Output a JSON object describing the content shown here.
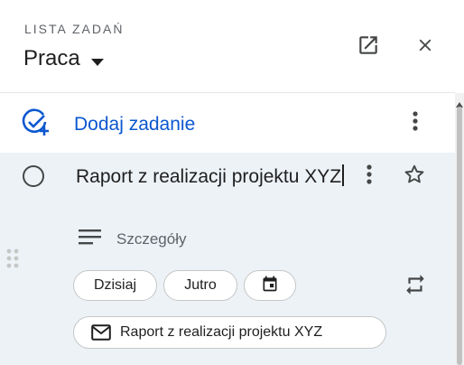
{
  "header": {
    "caption": "LISTA ZADAŃ",
    "list_name": "Praca",
    "icons": {
      "open": "open-in-new-icon",
      "close": "close-icon",
      "dropdown": "caret-down-icon"
    }
  },
  "add_task": {
    "label": "Dodaj zadanie",
    "icon": "add-task-icon",
    "more_icon": "more-vert-icon"
  },
  "task": {
    "title": "Raport z realizacji projektu XYZ",
    "details_label": "Szczegóły",
    "chips": {
      "today": "Dzisiaj",
      "tomorrow": "Jutro"
    },
    "email_label": "Raport z realizacji projektu XYZ",
    "icons": {
      "complete": "circle-icon",
      "more": "more-vert-icon",
      "star": "star-outline-icon",
      "details": "notes-icon",
      "calendar": "calendar-icon",
      "repeat": "repeat-icon",
      "email": "mail-icon",
      "drag": "drag-handle-icon"
    }
  },
  "colors": {
    "accent": "#0b57d0",
    "task_background": "#edf2f7",
    "text": "#1f1f1f",
    "secondary_text": "#5f6368",
    "chip_border": "#c4c7c5"
  }
}
